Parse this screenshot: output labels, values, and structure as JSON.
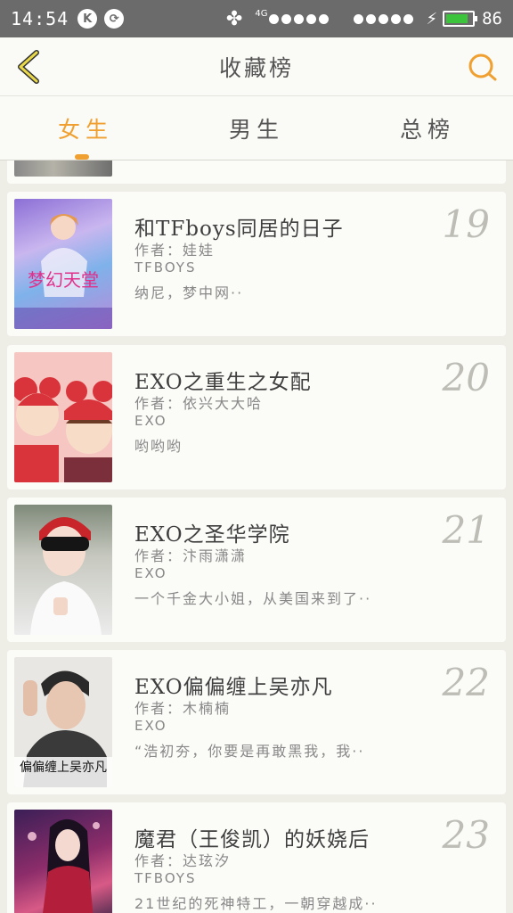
{
  "status_bar": {
    "time": "14:54",
    "icon_k": "K",
    "network": "4G",
    "battery_percent": "86",
    "battery_level": 0.86
  },
  "header": {
    "title": "收藏榜"
  },
  "tabs": [
    {
      "label": "女生",
      "active": true
    },
    {
      "label": "男生",
      "active": false
    },
    {
      "label": "总榜",
      "active": false
    }
  ],
  "books": [
    {
      "rank": "19",
      "title": "和TFboys同居的日子",
      "author": "作者：娃娃",
      "tag": "TFBOYS",
      "desc": "纳尼，梦中网··"
    },
    {
      "rank": "20",
      "title": "EXO之重生之女配",
      "author": "作者：依兴大大哈",
      "tag": "EXO",
      "desc": "哟哟哟"
    },
    {
      "rank": "21",
      "title": "EXO之圣华学院",
      "author": "作者：汴雨潇潇",
      "tag": "EXO",
      "desc": "一个千金大小姐，从美国来到了··"
    },
    {
      "rank": "22",
      "title": "EXO偏偏缠上吴亦凡",
      "author": "作者：木楠楠",
      "tag": "EXO",
      "desc": "“浩初夯，你要是再敢黑我，我··"
    },
    {
      "rank": "23",
      "title": "魔君（王俊凯）的妖娆后",
      "author": "作者：达玹汐",
      "tag": "TFBOYS",
      "desc": "21世纪的死神特工，一朝穿越成··"
    }
  ],
  "cover_texts": {
    "c19": "梦幻天堂",
    "c22": "偏偏缠上吴亦凡"
  }
}
